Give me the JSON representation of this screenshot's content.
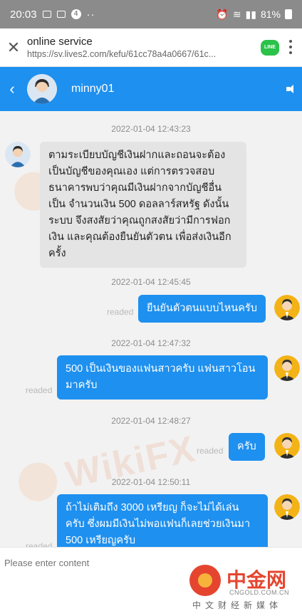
{
  "statusbar": {
    "time": "20:03",
    "misc": "··",
    "battery": "81%"
  },
  "browser": {
    "title": "online service",
    "url": "https://sv.lives2.com/kefu/61cc78a4a0667/61c...",
    "line_label": "LINE"
  },
  "chat": {
    "contact_name": "minny01"
  },
  "messages": [
    {
      "timestamp": "2022-01-04 12:43:23",
      "side": "in",
      "text": "ตามระเบียบบัญชีเงินฝากและถอนจะต้อง เป็นบัญชีของคุณเอง แต่การตรวจสอบ ธนาคารพบว่าคุณมีเงินฝากจากบัญชีอื่นเป็น จำนวนเงิน 500 ดอลลาร์สหรัฐ ดังนั้นระบบ จึงสงสัยว่าคุณถูกสงสัยว่ามีการฟอกเงิน และคุณต้องยืนยันตัวตน เพื่อส่งเงินอีกครั้ง"
    },
    {
      "timestamp": "2022-01-04 12:45:45",
      "side": "out",
      "text": "ยืนยันตัวตนแบบไหนครับ",
      "status": "readed"
    },
    {
      "timestamp": "2022-01-04 12:47:32",
      "side": "out",
      "text": "500 เป็นเงินของแฟนสาวครับ แฟนสาวโอน มาครับ",
      "status": "readed"
    },
    {
      "timestamp": "2022-01-04 12:48:27",
      "side": "out",
      "text": "ครับ",
      "status": "readed"
    },
    {
      "timestamp": "2022-01-04 12:50:11",
      "side": "out",
      "text": "ถ้าไม่เติมถึง 3000 เหรียญ ก็จะไม่ได้เล่น ครับ ซึ่งผมมีเงินไม่พอแฟนก็เลยช่วยเงินมา 500 เหรียญครับ",
      "status": "readed"
    }
  ],
  "input": {
    "placeholder": "Please enter content"
  },
  "watermark": {
    "text": "WikiFX"
  },
  "branding": {
    "cn_name": "中金网",
    "domain": "CNGOLD.COM.CN",
    "sub": "中文财经新媒体"
  },
  "colors": {
    "header_blue": "#1e90ef",
    "incoming_bubble": "#e4e4e4",
    "outgoing_bubble": "#1e90ef",
    "status_bar": "#8b8b8b"
  }
}
